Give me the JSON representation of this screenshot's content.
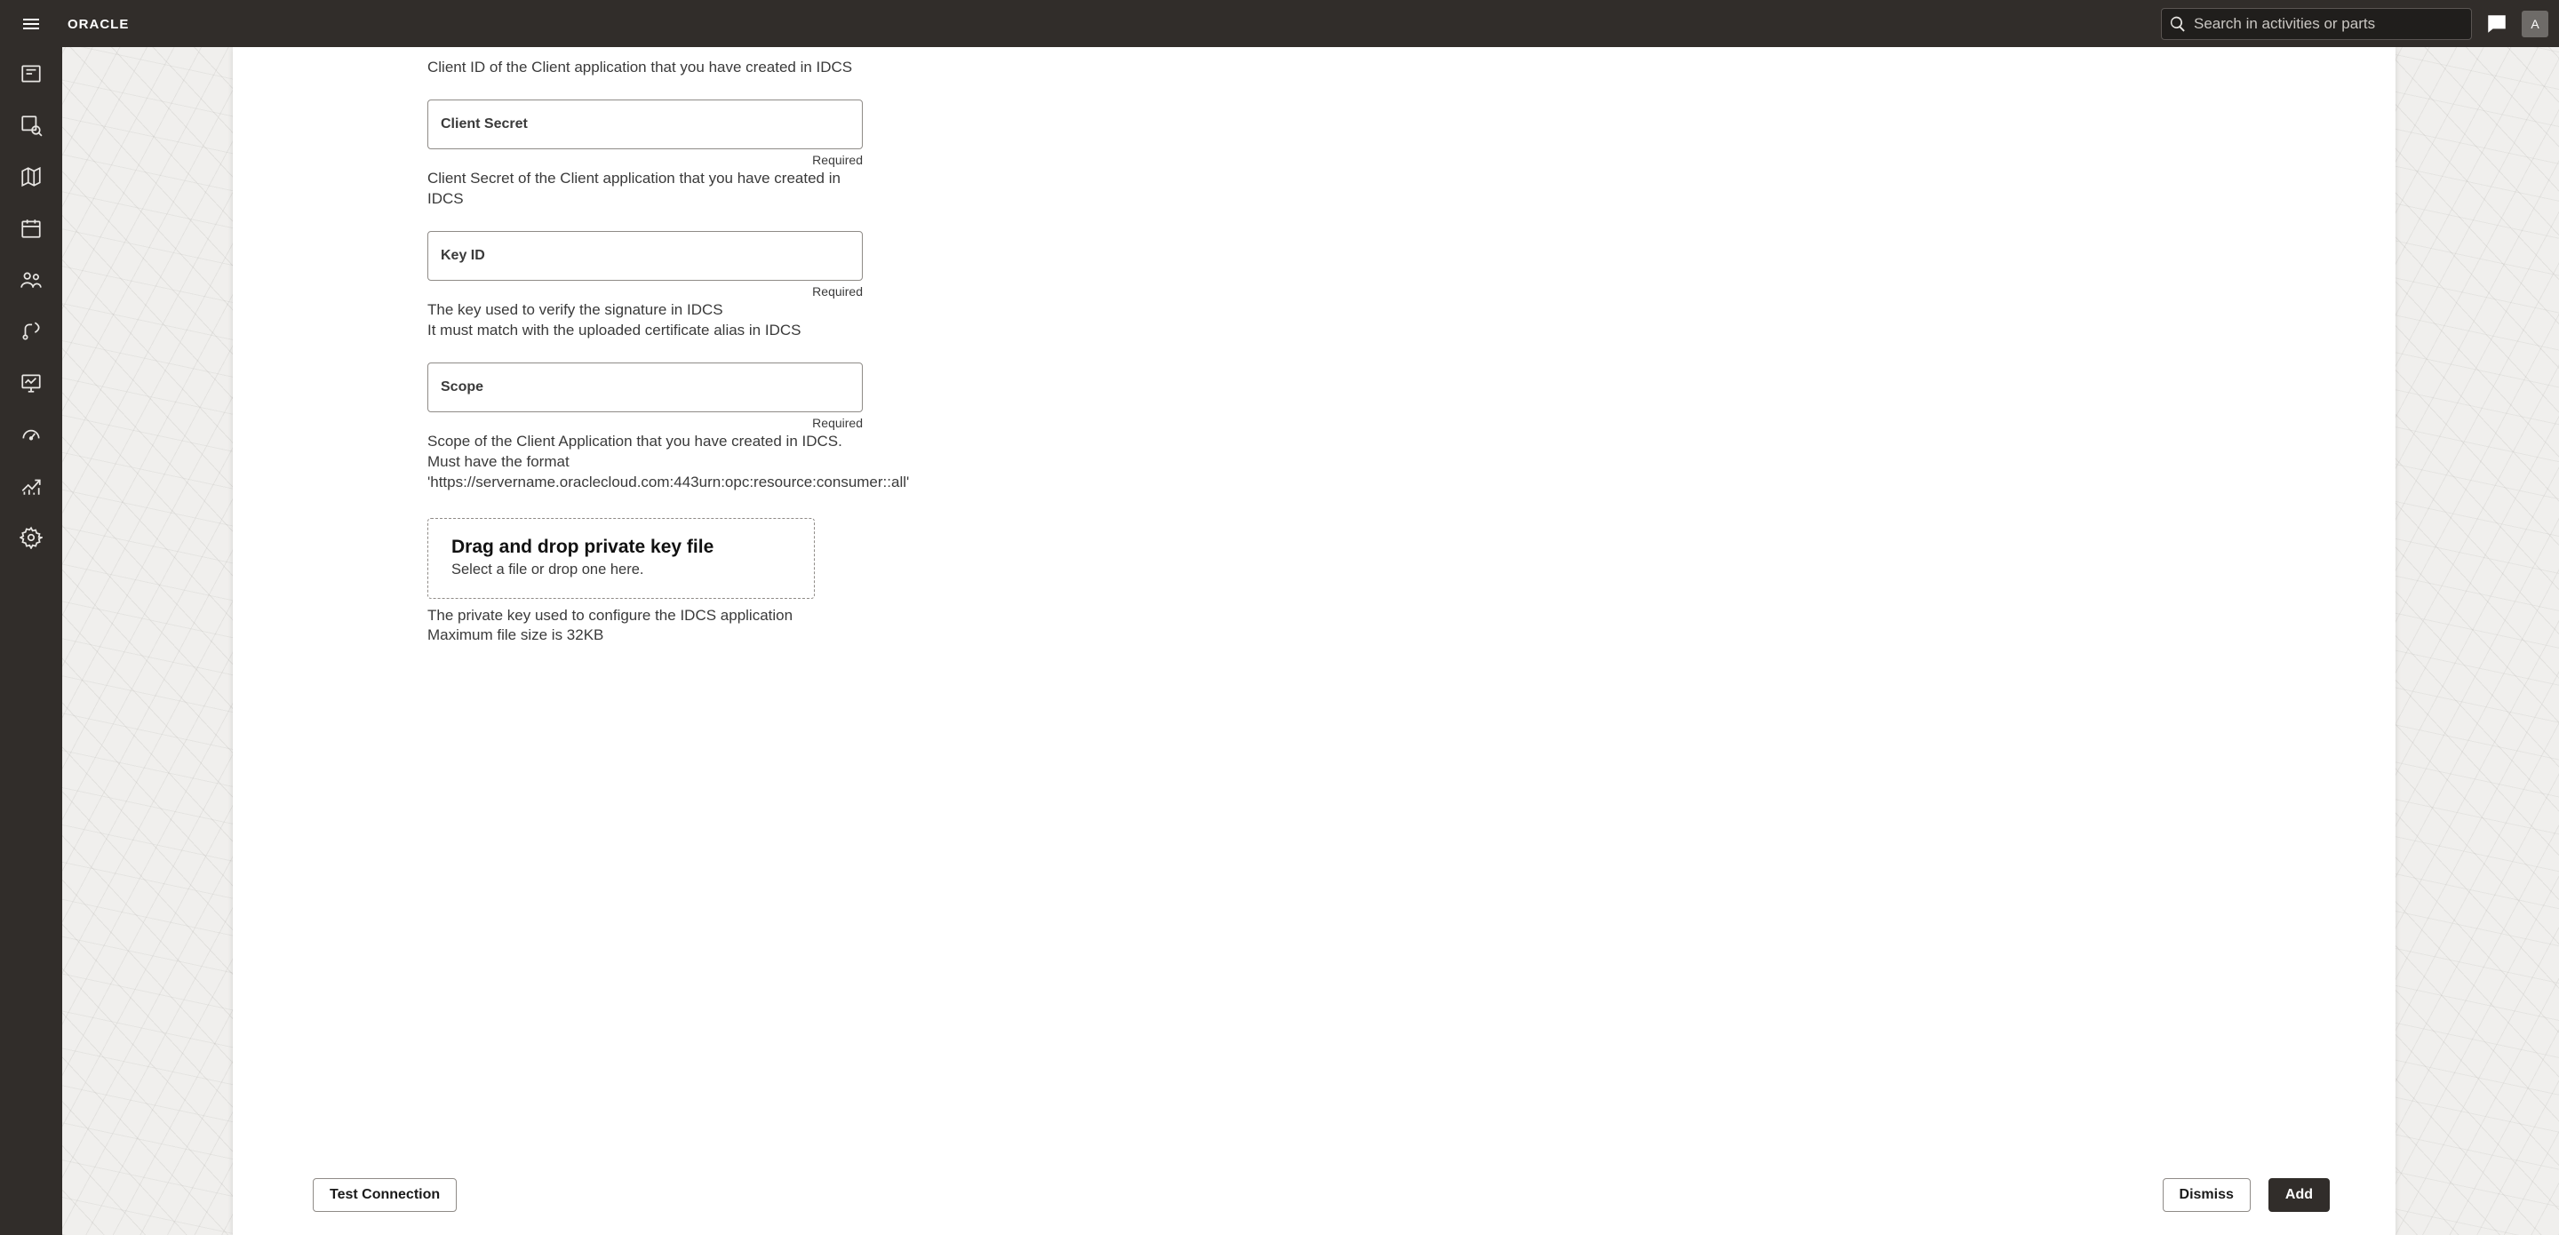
{
  "header": {
    "search_placeholder": "Search in activities or parts",
    "avatar_initial": "A"
  },
  "rail": {
    "items": [
      "dispatch-icon",
      "resource-search-icon",
      "map-icon",
      "calendar-icon",
      "team-icon",
      "route-icon",
      "monitor-icon",
      "gauge-icon",
      "trend-icon",
      "settings-gear-icon"
    ]
  },
  "form": {
    "client_id_help": "Client ID of the Client application that you have created in IDCS",
    "client_secret": {
      "label": "Client Secret",
      "required": "Required",
      "help": "Client Secret of the Client application that you have created in IDCS"
    },
    "key_id": {
      "label": "Key ID",
      "required": "Required",
      "help_line1": "The key used to verify the signature in IDCS",
      "help_line2": "It must match with the uploaded certificate alias in IDCS"
    },
    "scope": {
      "label": "Scope",
      "required": "Required",
      "help_line1": "Scope of the Client Application that you have created in IDCS.",
      "help_line2": "Must have the format",
      "help_line3": "'https://servername.oraclecloud.com:443urn:opc:resource:consumer::all'"
    },
    "dropzone": {
      "title": "Drag and drop private key file",
      "subtitle": "Select a file or drop one here."
    },
    "dropzone_help_line1": "The private key used to configure the IDCS application",
    "dropzone_help_line2": "Maximum file size is 32KB"
  },
  "footer": {
    "test_label": "Test Connection",
    "dismiss_label": "Dismiss",
    "add_label": "Add"
  }
}
